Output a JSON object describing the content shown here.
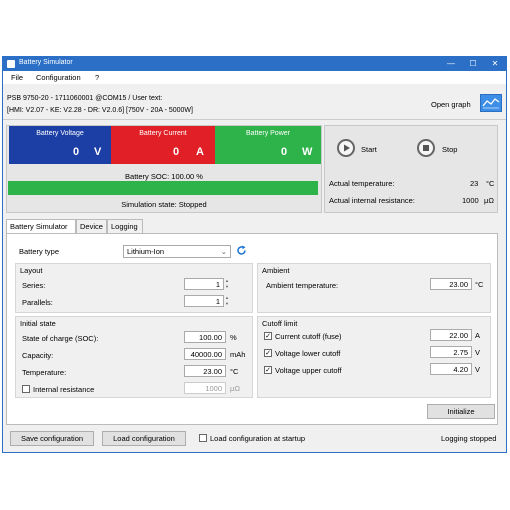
{
  "window": {
    "title": "Battery Simulator",
    "minimize": "—",
    "maximize": "☐",
    "close": "✕"
  },
  "menu": [
    "File",
    "Configuration",
    "?"
  ],
  "header": {
    "line1": "PSB 9750-20 - 1711060001 @COM15 / User text:",
    "line2": "[HMI: V2.07 - KE: V2.28 - DR: V2.0.6] [750V - 20A - 5000W]",
    "open_graph": "Open graph"
  },
  "meters": {
    "voltage": {
      "title": "Battery Voltage",
      "value": "0",
      "unit": "V",
      "color": "#1c3fa6"
    },
    "current": {
      "title": "Battery Current",
      "value": "0",
      "unit": "A",
      "color": "#e01f26"
    },
    "power": {
      "title": "Battery Power",
      "value": "0",
      "unit": "W",
      "color": "#2eb24a"
    }
  },
  "soc": {
    "label": "Battery SOC: 100.00 %",
    "fraction": 1.0
  },
  "sim_state": "Simulation state: Stopped",
  "controls": {
    "start": "Start",
    "stop": "Stop"
  },
  "status": {
    "temp_label": "Actual temperature:",
    "temp_value": "23",
    "temp_unit": "°C",
    "res_label": "Actual internal resistance:",
    "res_value": "1000",
    "res_unit": "μΩ"
  },
  "tabs": [
    "Battery Simulator",
    "Device",
    "Logging"
  ],
  "battery_type": {
    "label": "Battery type",
    "value": "Lithium-Ion"
  },
  "layout": {
    "title": "Layout",
    "series_label": "Series:",
    "series_value": "1",
    "parallels_label": "Parallels:",
    "parallels_value": "1"
  },
  "ambient": {
    "title": "Ambient",
    "label": "Ambient temperature:",
    "value": "23.00",
    "unit": "°C"
  },
  "initial_state": {
    "title": "Initial state",
    "soc_label": "State of charge (SOC):",
    "soc_value": "100.00",
    "soc_unit": "%",
    "cap_label": "Capacity:",
    "cap_value": "40000.00",
    "cap_unit": "mAh",
    "temp_label": "Temperature:",
    "temp_value": "23.00",
    "temp_unit": "°C",
    "ir_label": "Internal resistance",
    "ir_value": "1000",
    "ir_unit": "μΩ",
    "ir_checked": false
  },
  "cutoff": {
    "title": "Cutoff limit",
    "current_label": "Current cutoff (fuse)",
    "current_value": "22.00",
    "current_unit": "A",
    "vlow_label": "Voltage lower cutoff",
    "vlow_value": "2.75",
    "vlow_unit": "V",
    "vhigh_label": "Voltage upper cutoff",
    "vhigh_value": "4.20",
    "vhigh_unit": "V",
    "check_mark": "✓"
  },
  "initialize": "Initialize",
  "bottom": {
    "save": "Save configuration",
    "load": "Load configuration",
    "load_startup": "Load configuration at startup",
    "logging": "Logging stopped"
  }
}
